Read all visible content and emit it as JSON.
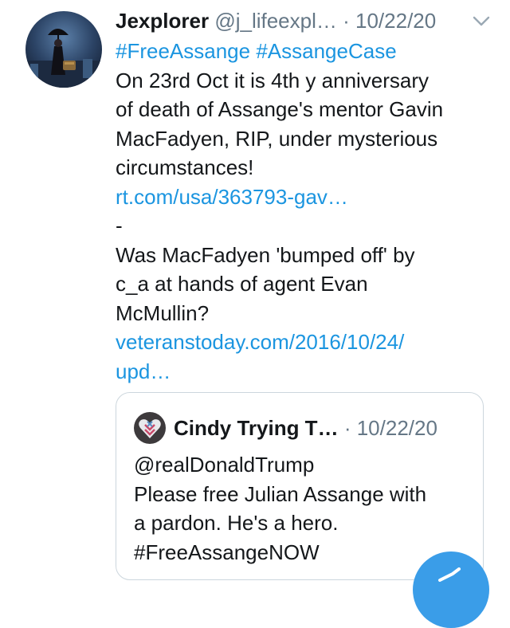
{
  "tweet": {
    "author_name": "Jexplorer",
    "handle": "@j_lifeexpl…",
    "separator": "·",
    "date": "10/22/20",
    "lines": [
      {
        "text": "#FreeAssange #AssangeCase",
        "kind": "link"
      },
      {
        "text": "On 23rd Oct it is 4th y anniversary",
        "kind": "text"
      },
      {
        "text": "of death of Assange's mentor Gavin",
        "kind": "text"
      },
      {
        "text": "MacFadyen, RIP, under mysterious",
        "kind": "text"
      },
      {
        "text": "circumstances!",
        "kind": "text"
      },
      {
        "text": "rt.com/usa/363793-gav…",
        "kind": "link"
      },
      {
        "text": "-",
        "kind": "text"
      },
      {
        "text": "Was MacFadyen 'bumped off' by",
        "kind": "text"
      },
      {
        "text": "c_a at hands of agent Evan",
        "kind": "text"
      },
      {
        "text": "McMullin?",
        "kind": "text"
      },
      {
        "text": "veteranstoday.com/2016/10/24/",
        "kind": "link"
      },
      {
        "text": "upd…",
        "kind": "link"
      }
    ]
  },
  "quoted_tweet": {
    "author_name": "Cindy Trying T…",
    "separator": "·",
    "date": "10/22/20",
    "lines": [
      "@realDonaldTrump",
      "Please free Julian Assange with",
      "a pardon. He's a hero.",
      "#FreeAssangeNOW"
    ]
  },
  "icons": {
    "caret": "chevron-down-icon",
    "compose": "compose-tweet-icon"
  },
  "colors": {
    "link": "#1b95e0",
    "muted": "#657786",
    "fab": "#3a9de8",
    "border": "#ccd6dd"
  }
}
